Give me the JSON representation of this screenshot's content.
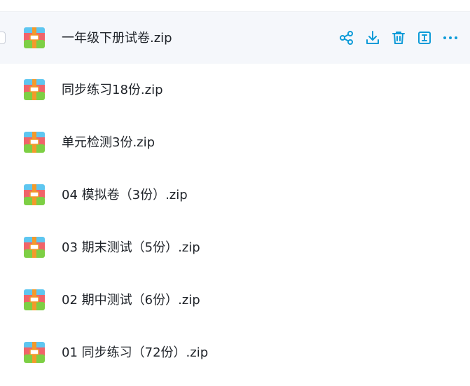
{
  "files": [
    {
      "name": "一年级下册试卷.zip",
      "selected": true
    },
    {
      "name": "同步练习18份.zip",
      "selected": false
    },
    {
      "name": "单元检测3份.zip",
      "selected": false
    },
    {
      "name": "04 模拟卷（3份）.zip",
      "selected": false
    },
    {
      "name": "03 期末测试（5份）.zip",
      "selected": false
    },
    {
      "name": "02 期中测试（6份）.zip",
      "selected": false
    },
    {
      "name": "01 同步练习（72份）.zip",
      "selected": false
    }
  ],
  "row_actions": [
    "share-icon",
    "download-icon",
    "trash-icon",
    "rename-icon",
    "more-icon"
  ],
  "colors": {
    "accent": "#0d9bd8",
    "selected_row_bg": "#f5f7fb",
    "text": "#1f2329",
    "zip_top": "#5ec6f0",
    "zip_middle": "#f0646a",
    "zip_bottom": "#7dcf44",
    "zip_zipper": "#f39a2b"
  }
}
